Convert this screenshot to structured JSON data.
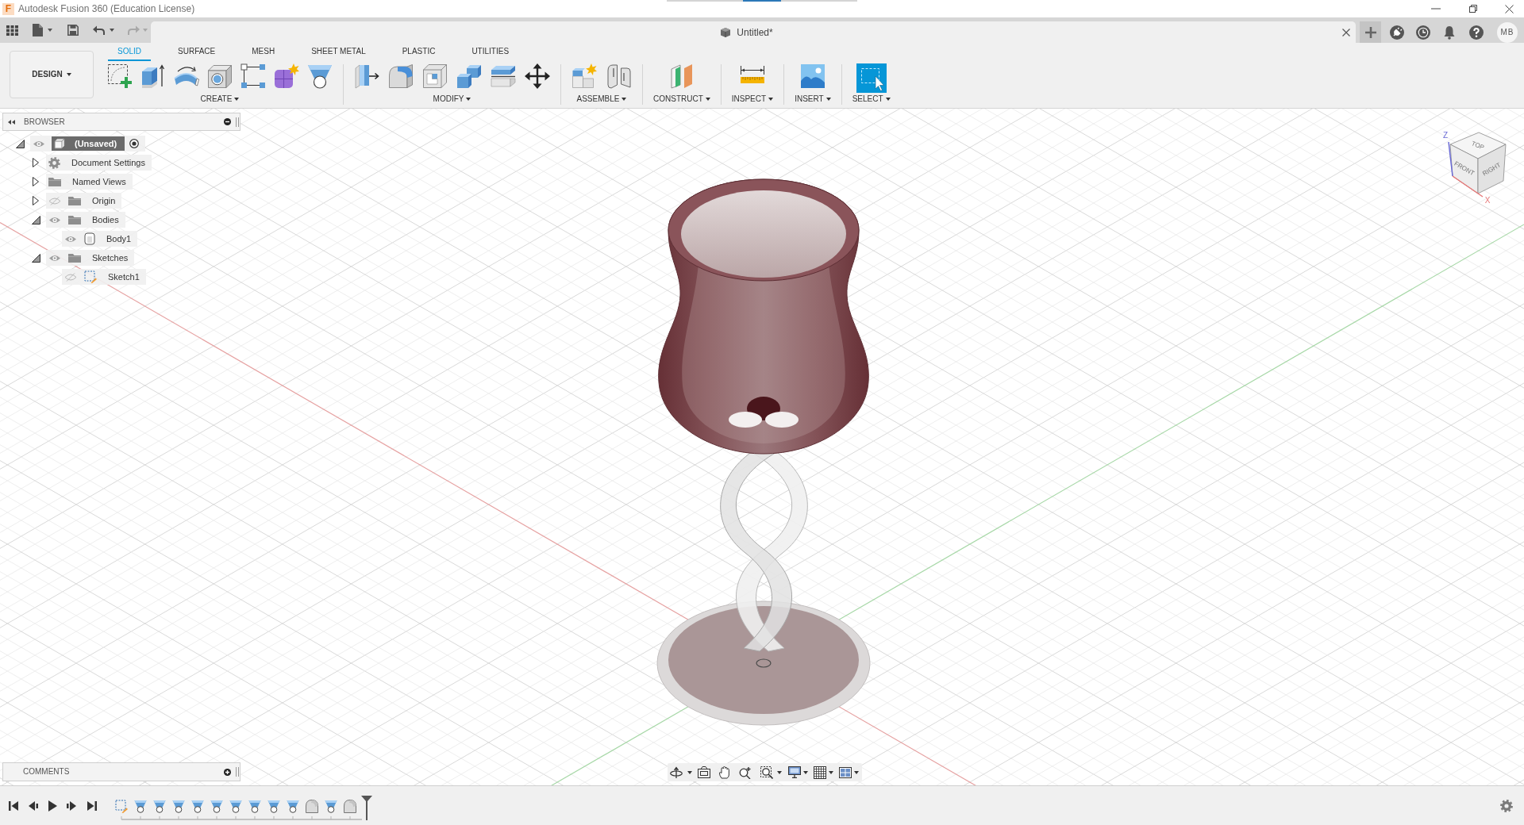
{
  "window": {
    "app_logo": "F",
    "title": "Autodesk Fusion 360 (Education License)"
  },
  "history": {
    "undo": {
      "disabled": false
    },
    "redo": {
      "disabled": true
    }
  },
  "document_tab": {
    "title": "Untitled*"
  },
  "user": {
    "initials": "MB"
  },
  "workspace": {
    "label": "DESIGN"
  },
  "toolbar_tabs": [
    {
      "label": "SOLID",
      "selected": true
    },
    {
      "label": "SURFACE",
      "selected": false
    },
    {
      "label": "MESH",
      "selected": false
    },
    {
      "label": "SHEET METAL",
      "selected": false
    },
    {
      "label": "PLASTIC",
      "selected": false
    },
    {
      "label": "UTILITIES",
      "selected": false
    }
  ],
  "tool_groups": [
    {
      "kind": "create",
      "label": "CREATE"
    },
    {
      "kind": "modify",
      "label": "MODIFY"
    },
    {
      "kind": "assemble",
      "label": "ASSEMBLE"
    },
    {
      "kind": "construct",
      "label": "CONSTRUCT"
    },
    {
      "kind": "inspect",
      "label": "INSPECT"
    },
    {
      "kind": "insert",
      "label": "INSERT"
    },
    {
      "kind": "select",
      "label": "SELECT"
    }
  ],
  "browser": {
    "title": "BROWSER",
    "tree": [
      {
        "kind": "component",
        "label": "(Unsaved)",
        "expanded": true,
        "visible": true,
        "active": true,
        "children": [
          {
            "kind": "settings",
            "label": "Document Settings",
            "expanded": false
          },
          {
            "kind": "folder",
            "label": "Named Views",
            "expanded": false
          },
          {
            "kind": "folder",
            "label": "Origin",
            "expanded": false,
            "visible": false
          },
          {
            "kind": "folder",
            "label": "Bodies",
            "expanded": true,
            "visible": true,
            "children": [
              {
                "kind": "body",
                "label": "Body1",
                "visible": true
              }
            ]
          },
          {
            "kind": "folder",
            "label": "Sketches",
            "expanded": true,
            "visible": true,
            "children": [
              {
                "kind": "sketch",
                "label": "Sketch1",
                "visible": false
              }
            ]
          }
        ]
      }
    ]
  },
  "comments": {
    "title": "COMMENTS"
  },
  "view_cube": {
    "top": "TOP",
    "front": "FRONT",
    "right": "RIGHT",
    "z_axis": "Z",
    "x_axis": "X"
  },
  "timeline": {
    "features": [
      {
        "kind": "sketch"
      },
      {
        "kind": "loft"
      },
      {
        "kind": "loft"
      },
      {
        "kind": "loft"
      },
      {
        "kind": "loft"
      },
      {
        "kind": "loft"
      },
      {
        "kind": "loft"
      },
      {
        "kind": "loft"
      },
      {
        "kind": "loft"
      },
      {
        "kind": "loft"
      },
      {
        "kind": "fillet"
      },
      {
        "kind": "loft"
      },
      {
        "kind": "fillet"
      }
    ]
  }
}
